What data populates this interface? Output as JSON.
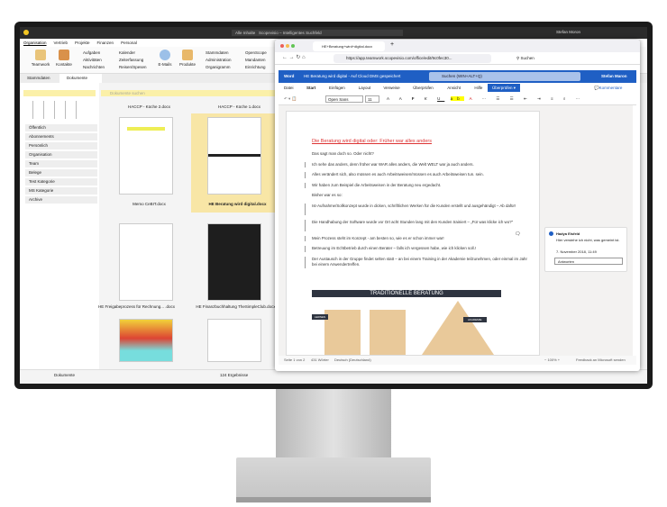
{
  "scopevisio": {
    "title_search_prefix": "Alle Inhalte",
    "title_search": "Scopevisio – Intelligentes Suchfeld",
    "user": "Stefan Moron",
    "ribbon_tabs": [
      "Organisation",
      "Vertrieb",
      "Projekte",
      "Finanzen",
      "Personal"
    ],
    "big_buttons": [
      "Teamwork",
      "Kontakte",
      "E-Mails",
      "Produkte"
    ],
    "col1": [
      "Aufgaben",
      "Aktivitäten",
      "Nachrichten"
    ],
    "col2": [
      "Kalender",
      "Zeiterfassung",
      "Reisen/Spesen"
    ],
    "col3": [
      "Stammdaten",
      "Administration",
      "Organigramm"
    ],
    "col4": [
      "OpenScope",
      "Mandanten",
      "Einrichtung"
    ],
    "subtabs": [
      "Stammdaten",
      "Dokumente"
    ],
    "doc_search_placeholder": "Dokumente suchen",
    "version_filter": "Versionsdatum",
    "categories": [
      "Öffentlich",
      "Abonnements",
      "Persönlich",
      "Organisation",
      "Team",
      "Belege",
      "Test Kategorie",
      "MS Kategorie",
      "Archive"
    ],
    "documents": [
      "HACCP - Küche 2.docx",
      "HACCP - Küche 1.docx",
      "Memo CeBIT.docx",
      "HE Beratung wird digital.docx",
      "HE Freigabeprozess für Rechnung... .docx",
      "HE Finanzbuchhaltung TheSimpleClub.docx"
    ],
    "status_label": "Dokumente",
    "result_count": "124 Ergebnisse"
  },
  "browser": {
    "tab_title": "HE+Beratung+wird+digital.docx",
    "url": "https://app.teamwork.scopevisio.com/office/edit/9c0fec30...",
    "search_placeholder": "Suchen"
  },
  "word": {
    "app": "Word",
    "doc_title": "HE Beratung wird digital - Auf Cloud DMS gespeichert",
    "search": "Suchen (WIN+ALT+Q)",
    "user": "Stefan Maron",
    "menu": [
      "Datei",
      "Start",
      "Einfügen",
      "Layout",
      "Verweise",
      "Überprüfen",
      "Ansicht",
      "Hilfe"
    ],
    "review_button": "Überprüfen",
    "comments_button": "Kommentare",
    "font": "Open Sans",
    "size": "11",
    "heading": "Die Beratung wird digital oder: Früher war alles anders",
    "paragraphs": [
      "Das sagt man doch so. Oder nicht?",
      "Ich sehe das anders, denn früher war WAR alles anders, die Welt WELT war ja auch anders.",
      "Alles verändert sich, also müssen es auch Arbeitsweisen/müssen es auch Arbeitsweisen tun. sein.",
      "Wir haben zum Beispiel die Arbeitsweisen in der Beratung neu ergedacht.",
      "Bisher war es so:",
      "Ist-Aufnahme/Sollkonzept wurde in dicken, schriftlichen Werken für die Kunden erstellt und ausgehändigt – Ab dafür!",
      "Die Handhabung der Software wurde vor Ort acht Stunden lang mit den Kunden trainiert – „Für was klicke ich wo?\"",
      "Mein Prozess steht im Konzept - am besten so, wie es er schon immer war!",
      "Betreuung im Echtbetrieb durch einen Berater – falls ich vergessen habe, wie ich klicken soll.!",
      "Der Austausch in der Gruppe findet selten statt – an bei einem Training in der Akademie teilzunehmen, oder einmal im Jahr bei einem Anwendertreffen."
    ],
    "banner": "TRADITIONELLE BERATUNG",
    "graphic_labels": [
      "LERNEN",
      "AKADEMIE"
    ],
    "comment": {
      "author": "Hadya Eisfeld",
      "text": "Hier verstehe ich nicht, was gemeint ist.",
      "date": "7. November 2018, 11:49",
      "reply_placeholder": "Antworten"
    },
    "status": {
      "page": "Seite 1 von 2",
      "words": "431 Wörter",
      "language": "Deutsch (Deutschland)",
      "zoom": "100%",
      "feedback": "Feedback an Microsoft senden"
    }
  },
  "colors": {
    "word_blue": "#1f5fc4",
    "search_yellow": "#fbf0a8",
    "selected_doc": "#f8e6a6"
  }
}
